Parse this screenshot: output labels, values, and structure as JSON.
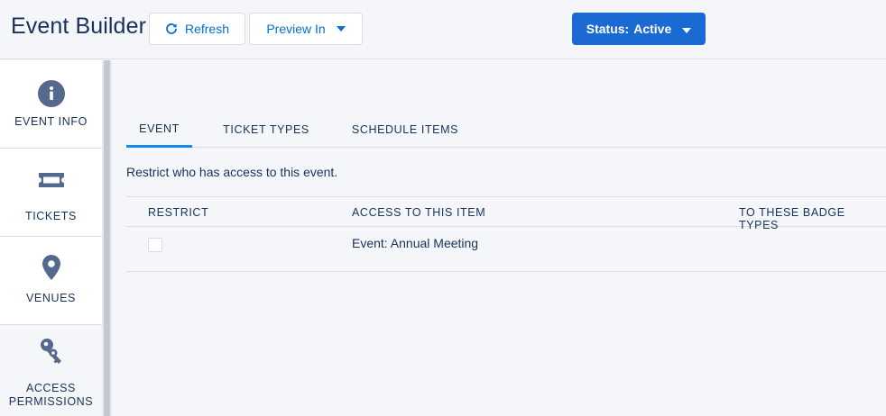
{
  "header": {
    "title": "Event Builder",
    "refresh_label": "Refresh",
    "preview_label": "Preview In",
    "status_prefix": "Status:",
    "status_value": "Active"
  },
  "sidebar": {
    "items": [
      {
        "label": "EVENT INFO",
        "icon": "info-icon"
      },
      {
        "label": "TICKETS",
        "icon": "ticket-icon"
      },
      {
        "label": "VENUES",
        "icon": "location-pin-icon"
      },
      {
        "label": "ACCESS PERMISSIONS",
        "icon": "key-icon"
      }
    ]
  },
  "tabs": [
    {
      "label": "EVENT",
      "active": true
    },
    {
      "label": "TICKET TYPES",
      "active": false
    },
    {
      "label": "SCHEDULE ITEMS",
      "active": false
    }
  ],
  "main": {
    "description": "Restrict who has access to this event.",
    "table": {
      "columns": [
        "RESTRICT",
        "ACCESS TO THIS ITEM",
        "TO THESE BADGE TYPES"
      ],
      "rows": [
        {
          "restrict": false,
          "item": "Event: Annual Meeting",
          "badge_types": ""
        }
      ]
    }
  },
  "colors": {
    "brand": "#1b6ad3",
    "link": "#0070d2",
    "text": "#16325c",
    "icon": "#54698d",
    "border": "#d8dde6",
    "active_tab": "#1589ee"
  }
}
